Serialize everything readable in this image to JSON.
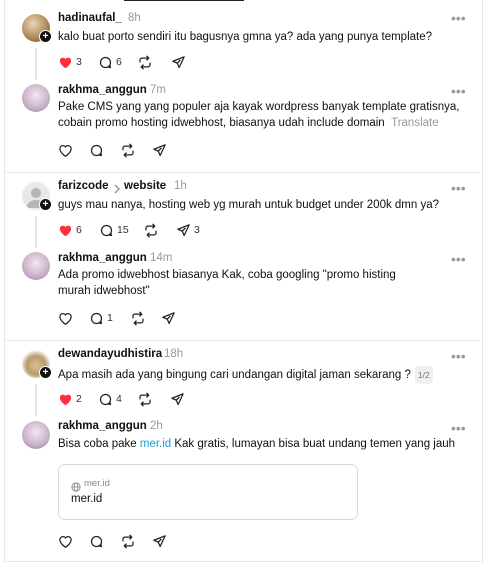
{
  "posts": [
    {
      "username": "hadinaufal_",
      "time": "8h",
      "text": "kalo buat porto sendiri itu bagusnya gmna ya? ada yang punya template?",
      "likes": "3",
      "comments": "6",
      "avatar": "photo-avatar"
    },
    {
      "username": "rakhma_anggun",
      "time": "7m",
      "text_line1": "Pake CMS yang yang populer aja kayak wordpress banyak template gratisnya,",
      "text_line2": "cobain promo hosting idwebhost, biasanya udah include domain",
      "translate": "Translate"
    },
    {
      "username": "farizcode",
      "topic": "website",
      "time": "1h",
      "text": "guys mau nanya, hosting web yg murah untuk budget under 200k dmn ya?",
      "likes": "6",
      "comments": "15",
      "shares": "3"
    },
    {
      "username": "rakhma_anggun",
      "time": "14m",
      "text_line1": "Ada promo idwebhost biasanya Kak, coba googling \"promo histing",
      "text_line2": "murah idwebhost\"",
      "comments": "1"
    },
    {
      "username": "dewandayudhistira",
      "time": "18h",
      "text": "Apa masih ada yang bingung cari undangan digital jaman sekarang ?",
      "page": "1/2",
      "likes": "2",
      "comments": "4"
    },
    {
      "username": "rakhma_anggun",
      "time": "2h",
      "text_before": "Bisa coba pake ",
      "link": "mer.id",
      "text_after": " Kak gratis, lumayan bisa buat undang temen yang jauh",
      "card_domain": "mer.id",
      "card_title": "mer.id"
    }
  ],
  "colors": {
    "like_red": "#ff3040",
    "link_blue": "#1d9bd1",
    "muted": "#999999"
  },
  "icons": [
    "heart-icon",
    "comment-icon",
    "repost-icon",
    "share-icon",
    "more-icon",
    "globe-icon",
    "chevron-right-icon"
  ]
}
